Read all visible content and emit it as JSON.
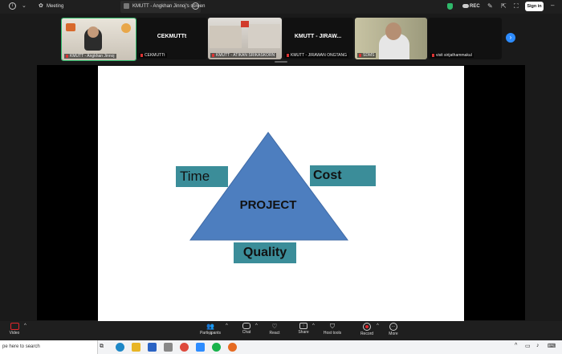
{
  "window": {
    "app_title": "Meeting",
    "share_tab_title": "KMUTT - Angkhan Jinnoj's screen",
    "rec_label": "REC",
    "sign_in_label": "Sign in"
  },
  "participants": [
    {
      "name": "KMUTT - Angkhan Jinnoj",
      "center": "",
      "has_video": true,
      "active": true
    },
    {
      "name": "CEKMUTTt",
      "center": "CEKMUTTt",
      "has_video": false,
      "active": false
    },
    {
      "name": "KMUTT - ATIKAN SRIKASKORN",
      "center": "",
      "has_video": true,
      "active": false
    },
    {
      "name": "KMUTT - JIRAWAN ONGTANG",
      "center": "KMUTT - JIRAW...",
      "has_video": false,
      "active": false
    },
    {
      "name": "SDMS",
      "center": "",
      "has_video": true,
      "active": false
    },
    {
      "name": "visit sirijathammakul",
      "center": "",
      "has_video": false,
      "active": false
    }
  ],
  "slide": {
    "time_label": "Time",
    "cost_label": "Cost",
    "project_label": "PROJECT",
    "quality_label": "Quality",
    "triangle_color": "#4d7ebf",
    "box_color": "#3b8d99"
  },
  "toolbar": {
    "video_label": "Video",
    "participants_label": "Participants",
    "participants_count": "70",
    "chat_label": "Chat",
    "react_label": "React",
    "share_label": "Share",
    "host_tools_label": "Host tools",
    "record_label": "Record",
    "more_label": "More"
  },
  "taskbar": {
    "search_placeholder": "pe here to search"
  },
  "colors": {
    "accent_green": "#2fb86a",
    "record_red": "#e0262b",
    "nav_blue": "#2d8cff"
  }
}
